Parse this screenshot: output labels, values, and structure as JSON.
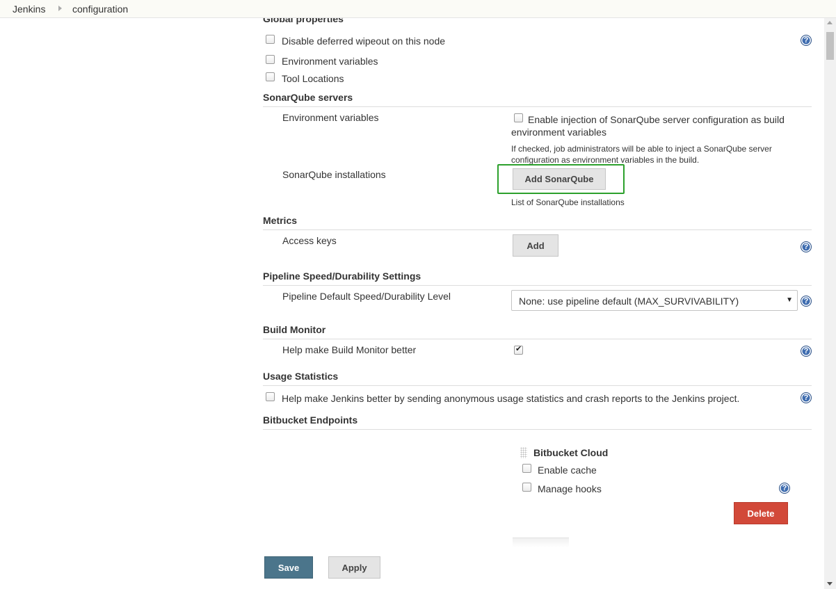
{
  "breadcrumb": {
    "items": [
      "Jenkins",
      "configuration"
    ]
  },
  "global_properties": {
    "header": "Global properties",
    "items": [
      "Disable deferred wipeout on this node",
      "Environment variables",
      "Tool Locations"
    ]
  },
  "sonarqube": {
    "header": "SonarQube servers",
    "env_label": "Environment variables",
    "env_checkbox_line1": "Enable injection of SonarQube server configuration as build",
    "env_checkbox_line2": "environment variables",
    "env_help_line1": "If checked, job administrators will be able to inject a SonarQube server",
    "env_help_line2": "configuration as environment variables in the build.",
    "installations_label": "SonarQube installations",
    "add_button": "Add SonarQube",
    "installations_desc": "List of SonarQube installations"
  },
  "metrics": {
    "header": "Metrics",
    "access_keys_label": "Access keys",
    "add_button": "Add"
  },
  "pipeline": {
    "header": "Pipeline Speed/Durability Settings",
    "level_label": "Pipeline Default Speed/Durability Level",
    "selected": "None: use pipeline default (MAX_SURVIVABILITY)"
  },
  "build_monitor": {
    "header": "Build Monitor",
    "label": "Help make Build Monitor better",
    "checked": true
  },
  "usage": {
    "header": "Usage Statistics",
    "label": "Help make Jenkins better by sending anonymous usage statistics and crash reports to the Jenkins project."
  },
  "bitbucket": {
    "header": "Bitbucket Endpoints",
    "cloud_title": "Bitbucket Cloud",
    "enable_cache": "Enable cache",
    "manage_hooks": "Manage hooks",
    "delete_button": "Delete"
  },
  "footer": {
    "save": "Save",
    "apply": "Apply"
  },
  "icons": {
    "help": "help-icon",
    "checkbox": "checkbox-icon",
    "drag": "drag-handle-icon",
    "dropdown": "chevron-down-icon"
  },
  "colors": {
    "accent": "#4b758b",
    "danger": "#d24939",
    "highlight": "#2ca02c",
    "help": "#3f6db0"
  }
}
